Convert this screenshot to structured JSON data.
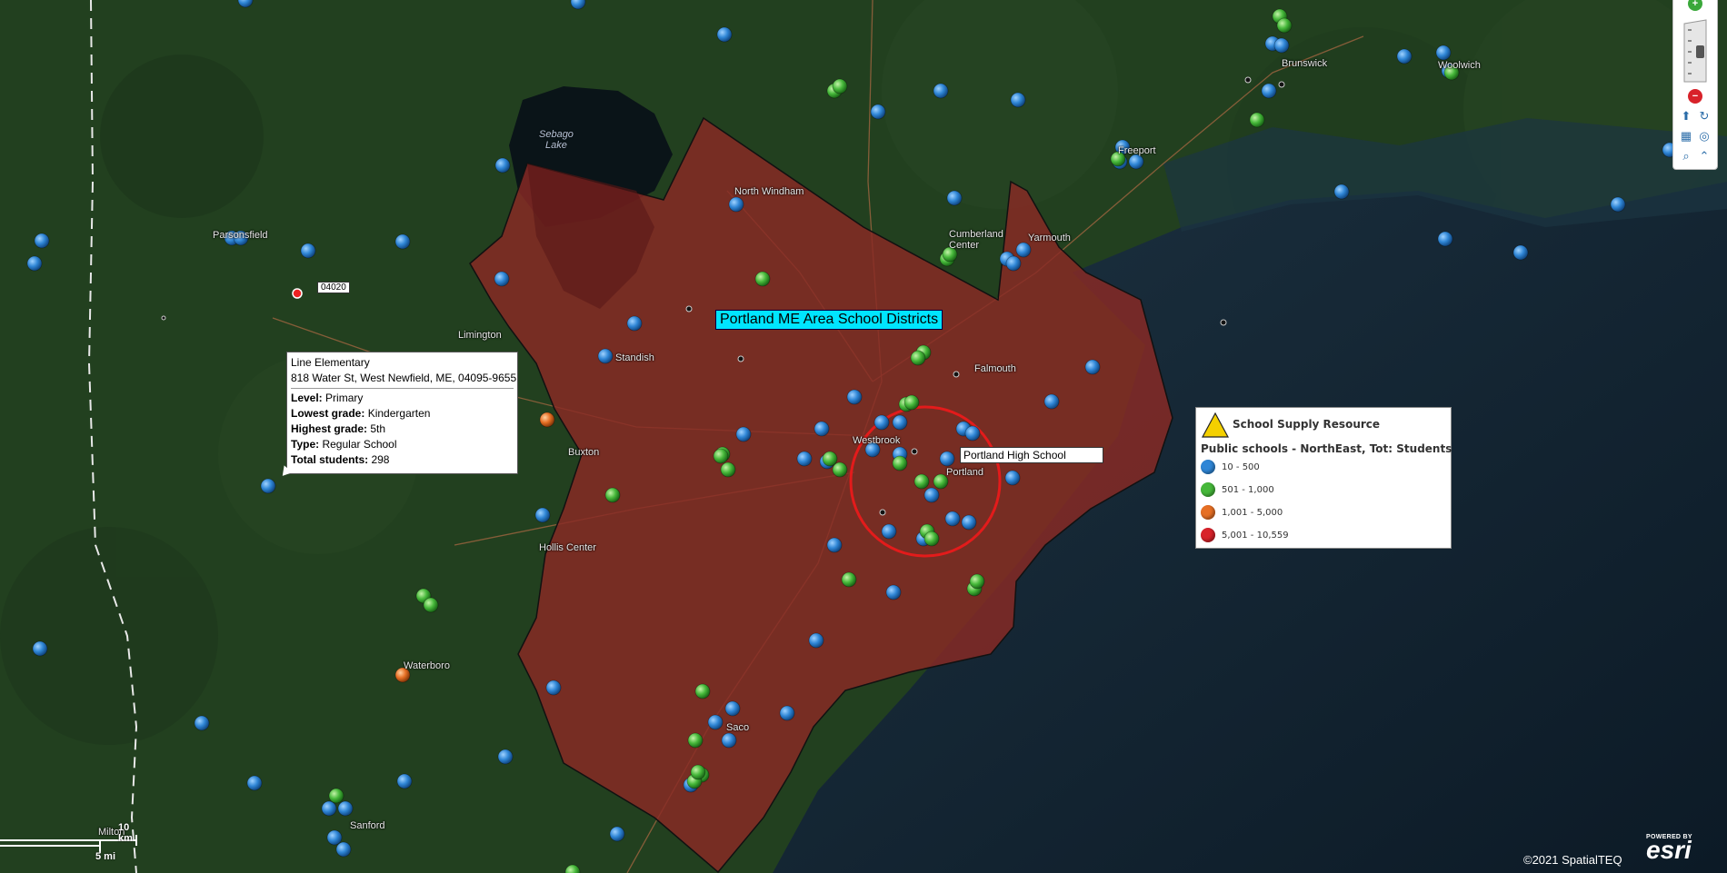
{
  "map": {
    "title": "Portland ME Area School Districts",
    "highlight_label": "Portland High School",
    "zip_label": "04020"
  },
  "places": {
    "sebago": "Sebago\nLake",
    "north_windham": "North Windham",
    "cumberland": "Cumberland\nCenter",
    "yarmouth": "Yarmouth",
    "brunswick": "Brunswick",
    "woolwich": "Woolwich",
    "freeport": "Freeport",
    "parsonsfield": "Parsonsfield",
    "limington": "Limington",
    "standish": "Standish",
    "falmouth": "Falmouth",
    "westbrook": "Westbrook",
    "portland": "Portland",
    "buxton": "Buxton",
    "hollis": "Hollis Center",
    "waterboro": "Waterboro",
    "saco": "Saco",
    "sanford": "Sanford",
    "milton": "Milton"
  },
  "popup": {
    "name": "Line Elementary",
    "address": "818 Water St, West Newfield, ME, 04095-9655",
    "level_label": "Level:",
    "level": "Primary",
    "lowest_label": "Lowest grade:",
    "lowest": "Kindergarten",
    "highest_label": "Highest grade:",
    "highest": "5th",
    "type_label": "Type:",
    "type": "Regular School",
    "total_label": "Total students:",
    "total": "298"
  },
  "legend": {
    "title": "School Supply Resource",
    "subtitle": "Public schools - NorthEast, Tot: Students",
    "items": [
      {
        "label": "10 - 500",
        "color": "#2f86d6"
      },
      {
        "label": "501 - 1,000",
        "color": "#46b83a"
      },
      {
        "label": "1,001 - 5,000",
        "color": "#e66f24"
      },
      {
        "label": "5,001 - 10,559",
        "color": "#d8222a"
      }
    ],
    "triangle_color": "#f4d000"
  },
  "scale": {
    "km": "10 km",
    "mi": "5 mi"
  },
  "footer": {
    "copyright": "©2021 SpatialTEQ",
    "esri_powered": "POWERED BY",
    "esri_name": "esri"
  },
  "colors": {
    "district_fill": "#8a2a25",
    "ring": "#e31b1b",
    "land": "#233f24",
    "ocean": "#0f1f2a"
  },
  "toolbar": {
    "zoom_in_icon": "zoom-in-icon",
    "zoom_out_icon": "zoom-out-icon",
    "pan_icon": "pan-icon",
    "search_icon": "search-icon"
  }
}
